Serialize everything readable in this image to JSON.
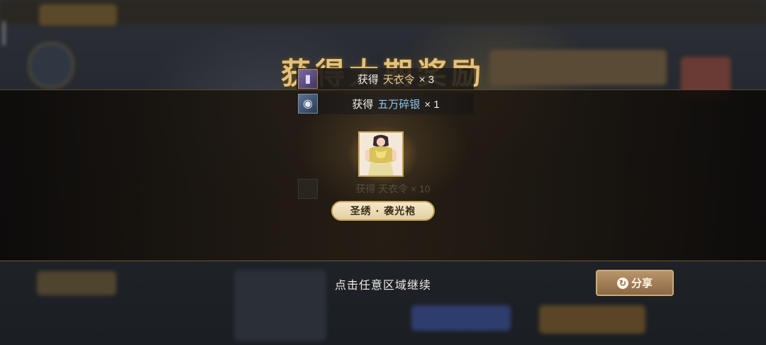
{
  "title": "获得大期奖励",
  "rewards": [
    {
      "prefix": "获得",
      "name": "天衣令",
      "count": "× 3",
      "icon": "token-icon"
    },
    {
      "prefix": "获得",
      "name": "五万碎银",
      "count": "× 1",
      "icon": "silver-icon"
    }
  ],
  "ghost_reward": {
    "text": "获得 天衣令 × 10"
  },
  "featured_item": {
    "name": "圣绣 · 袭光袍",
    "icon": "costume-icon"
  },
  "hint": "点击任意区域继续",
  "share_label": "分享",
  "colors": {
    "gold": "#e4c27c",
    "item_name_blue": "#8cc4ec",
    "item_name_gold": "#e9c98f"
  }
}
